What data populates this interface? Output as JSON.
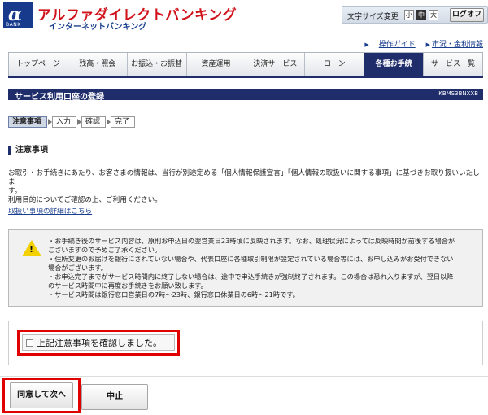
{
  "header": {
    "logo_alpha": "α",
    "logo_bank": "BANK",
    "brand_title": "アルファダイレクトバンキング",
    "brand_sub": "インターネットバンキング",
    "font_size_label": "文字サイズ変更",
    "font_sizes": [
      "小",
      "中",
      "大"
    ],
    "font_size_selected": "中",
    "logoff": "ログオフ"
  },
  "sublinks": [
    {
      "label": "操作ガイド"
    },
    {
      "label": "市況・金利情報"
    }
  ],
  "nav": {
    "items": [
      "トップページ",
      "残高・照会",
      "お振込・お振替",
      "資産運用",
      "決済サービス",
      "ローン",
      "各種お手続",
      "サービス一覧"
    ],
    "active": "各種お手続"
  },
  "page": {
    "title": "サービス利用口座の登録",
    "code": "KBMS3BNXXB"
  },
  "steps": [
    "注意事項",
    "入力",
    "確認",
    "完了"
  ],
  "section": {
    "heading": "注意事項",
    "body_line1": "お取引・お手続きにあたり、お客さまの情報は、当行が別途定める「個人情報保護宣言」「個人情報の取扱いに関する事項」に基づきお取り扱いいたしま",
    "body_line2": "す。",
    "body_line3": "利用目的についてご確認の上、ご利用ください。",
    "detail_link": "取扱い事項の詳細はこちら"
  },
  "notice": {
    "lines": [
      "・お手続き後のサービス内容は、原則お申込日の翌営業日23時頃に反映されます。なお、処理状況によっては反映時間が前後する場合が",
      "ございますので予めご了承ください。",
      "・住所変更のお届けを銀行にされていない場合や、代表口座に各種取引制限が設定されている場合等には、お申し込みがお受付できない",
      "場合がございます。",
      "・お申込完了までがサービス時間内に終了しない場合は、途中で申込手続きが強制終了されます。この場合は恐れ入りますが、翌日以降",
      "のサービス時間中に再度お手続きをお願い致します。",
      "・サービス時間は銀行窓口営業日の7時〜23時、銀行窓口休業日の6時〜21時です。"
    ]
  },
  "confirm": {
    "label": "上記注意事項を確認しました。"
  },
  "buttons": {
    "agree": "同意して次へ",
    "cancel": "中止"
  },
  "colors": {
    "brand_red": "#d0121b",
    "brand_navy": "#1f2d6b",
    "highlight_red": "#e00000"
  }
}
